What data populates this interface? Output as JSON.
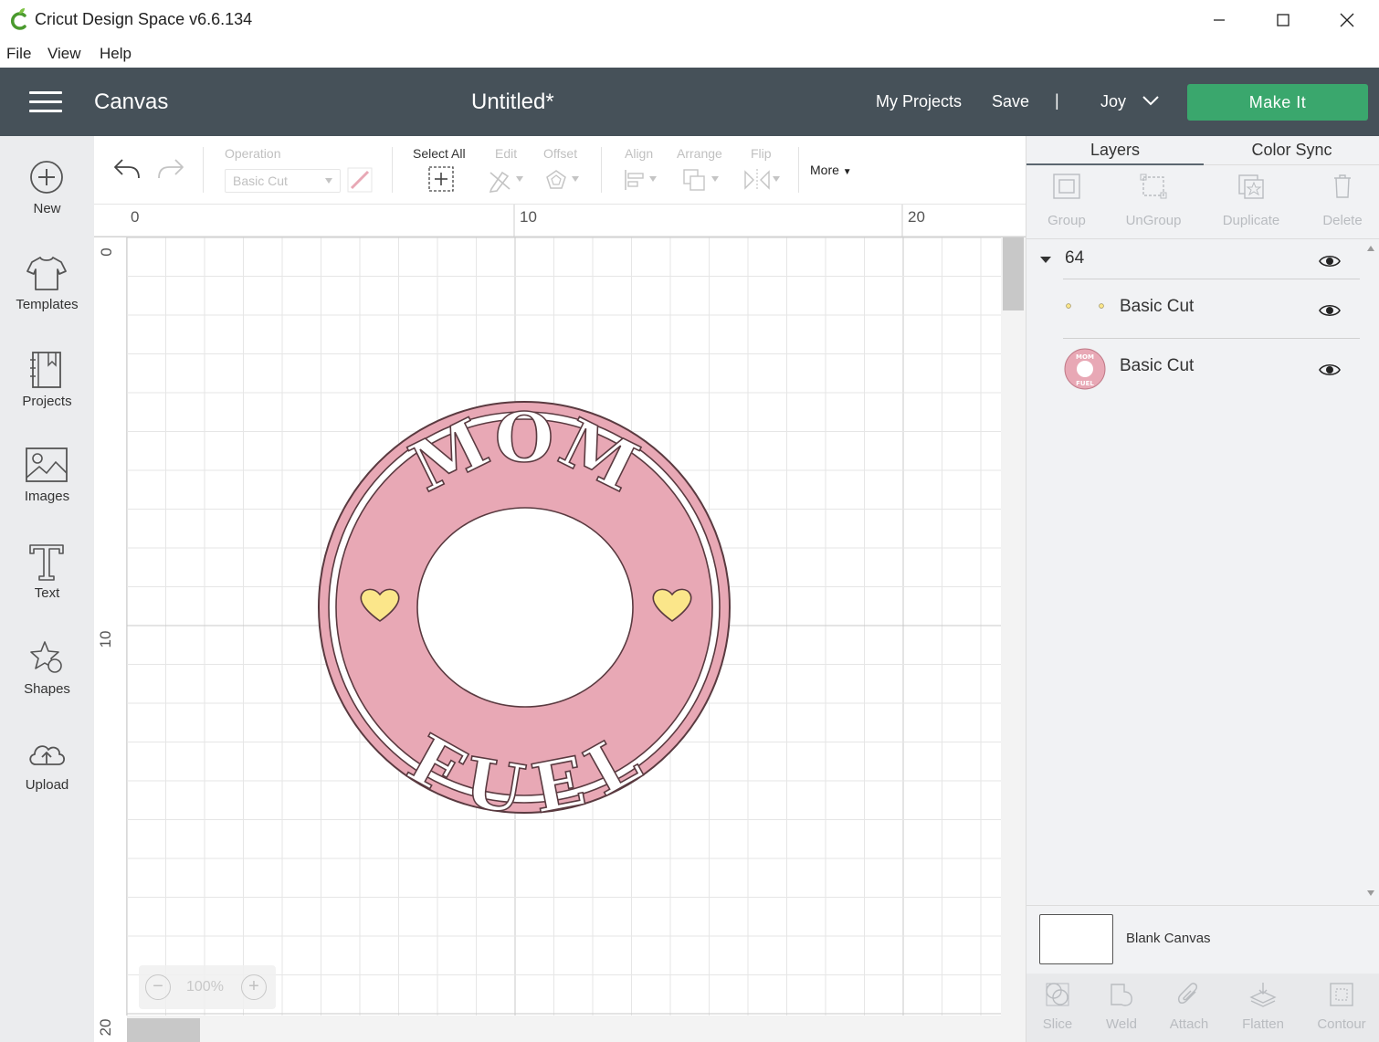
{
  "window": {
    "title": "Cricut Design Space  v6.6.134",
    "controls": [
      "minimize-icon",
      "maximize-icon",
      "close-icon"
    ]
  },
  "menu": {
    "items": [
      "File",
      "View",
      "Help"
    ]
  },
  "header": {
    "section": "Canvas",
    "document_title": "Untitled*",
    "my_projects": "My Projects",
    "save": "Save",
    "separator": "|",
    "user": "Joy",
    "make_it": "Make It",
    "colors": {
      "bar": "#465159",
      "make_it": "#3aa76d"
    }
  },
  "sidebar": {
    "items": [
      {
        "label": "New",
        "icon": "plus-circle-icon"
      },
      {
        "label": "Templates",
        "icon": "tshirt-icon"
      },
      {
        "label": "Projects",
        "icon": "notebook-icon"
      },
      {
        "label": "Images",
        "icon": "image-icon"
      },
      {
        "label": "Text",
        "icon": "text-t-icon"
      },
      {
        "label": "Shapes",
        "icon": "shapes-icon"
      },
      {
        "label": "Upload",
        "icon": "cloud-upload-icon"
      }
    ]
  },
  "toolbar": {
    "operation_label": "Operation",
    "operation_value": "Basic Cut",
    "select_all": "Select All",
    "edit": "Edit",
    "offset": "Offset",
    "align": "Align",
    "arrange": "Arrange",
    "flip": "Flip",
    "more": "More"
  },
  "rulers": {
    "top": [
      "0",
      "10",
      "20"
    ],
    "left": [
      "0",
      "10",
      "20"
    ]
  },
  "canvas": {
    "zoom": "100%",
    "zoom_out": "−",
    "zoom_in": "+",
    "design": {
      "top_text": "MOM",
      "bottom_text": "FUEL",
      "colors": {
        "ring": "#e8a8b5",
        "outline": "#5a3a40",
        "heart": "#fbe68a"
      }
    }
  },
  "layers_panel": {
    "tabs": [
      "Layers",
      "Color Sync"
    ],
    "tools": [
      "Group",
      "UnGroup",
      "Duplicate",
      "Delete"
    ],
    "group_name": "64",
    "layers": [
      {
        "name": "Basic Cut",
        "thumb": "dots-thumbnail"
      },
      {
        "name": "Basic Cut",
        "thumb": "mom-fuel-ring-thumbnail"
      }
    ],
    "blank_canvas": "Blank Canvas",
    "bottom_tools": [
      "Slice",
      "Weld",
      "Attach",
      "Flatten",
      "Contour"
    ]
  }
}
